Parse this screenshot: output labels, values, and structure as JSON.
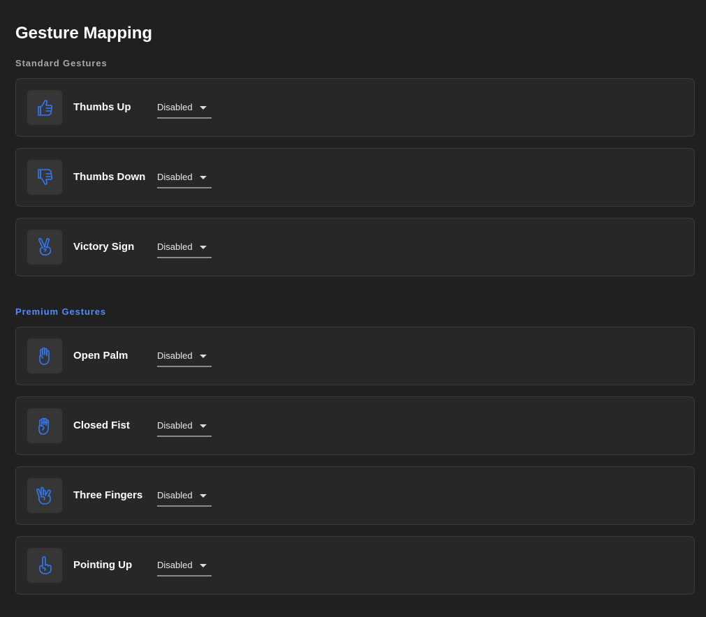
{
  "page": {
    "title": "Gesture Mapping"
  },
  "theme": {
    "accent": "#3478F6",
    "premium_heading": "#4F8CFF",
    "background": "#202020",
    "card": "#272727"
  },
  "sections": [
    {
      "title": "Standard Gestures",
      "items": [
        {
          "label": "Thumbs Up",
          "icon": "thumbs-up-icon",
          "mapping": "Disabled"
        },
        {
          "label": "Thumbs Down",
          "icon": "thumbs-down-icon",
          "mapping": "Disabled"
        },
        {
          "label": "Victory Sign",
          "icon": "victory-sign-icon",
          "mapping": "Disabled"
        }
      ]
    },
    {
      "title": "Premium Gestures",
      "items": [
        {
          "label": "Open Palm",
          "icon": "open-palm-icon",
          "mapping": "Disabled"
        },
        {
          "label": "Closed Fist",
          "icon": "closed-fist-icon",
          "mapping": "Disabled"
        },
        {
          "label": "Three Fingers",
          "icon": "three-fingers-icon",
          "mapping": "Disabled"
        },
        {
          "label": "Pointing Up",
          "icon": "pointing-up-icon",
          "mapping": "Disabled"
        }
      ]
    }
  ]
}
